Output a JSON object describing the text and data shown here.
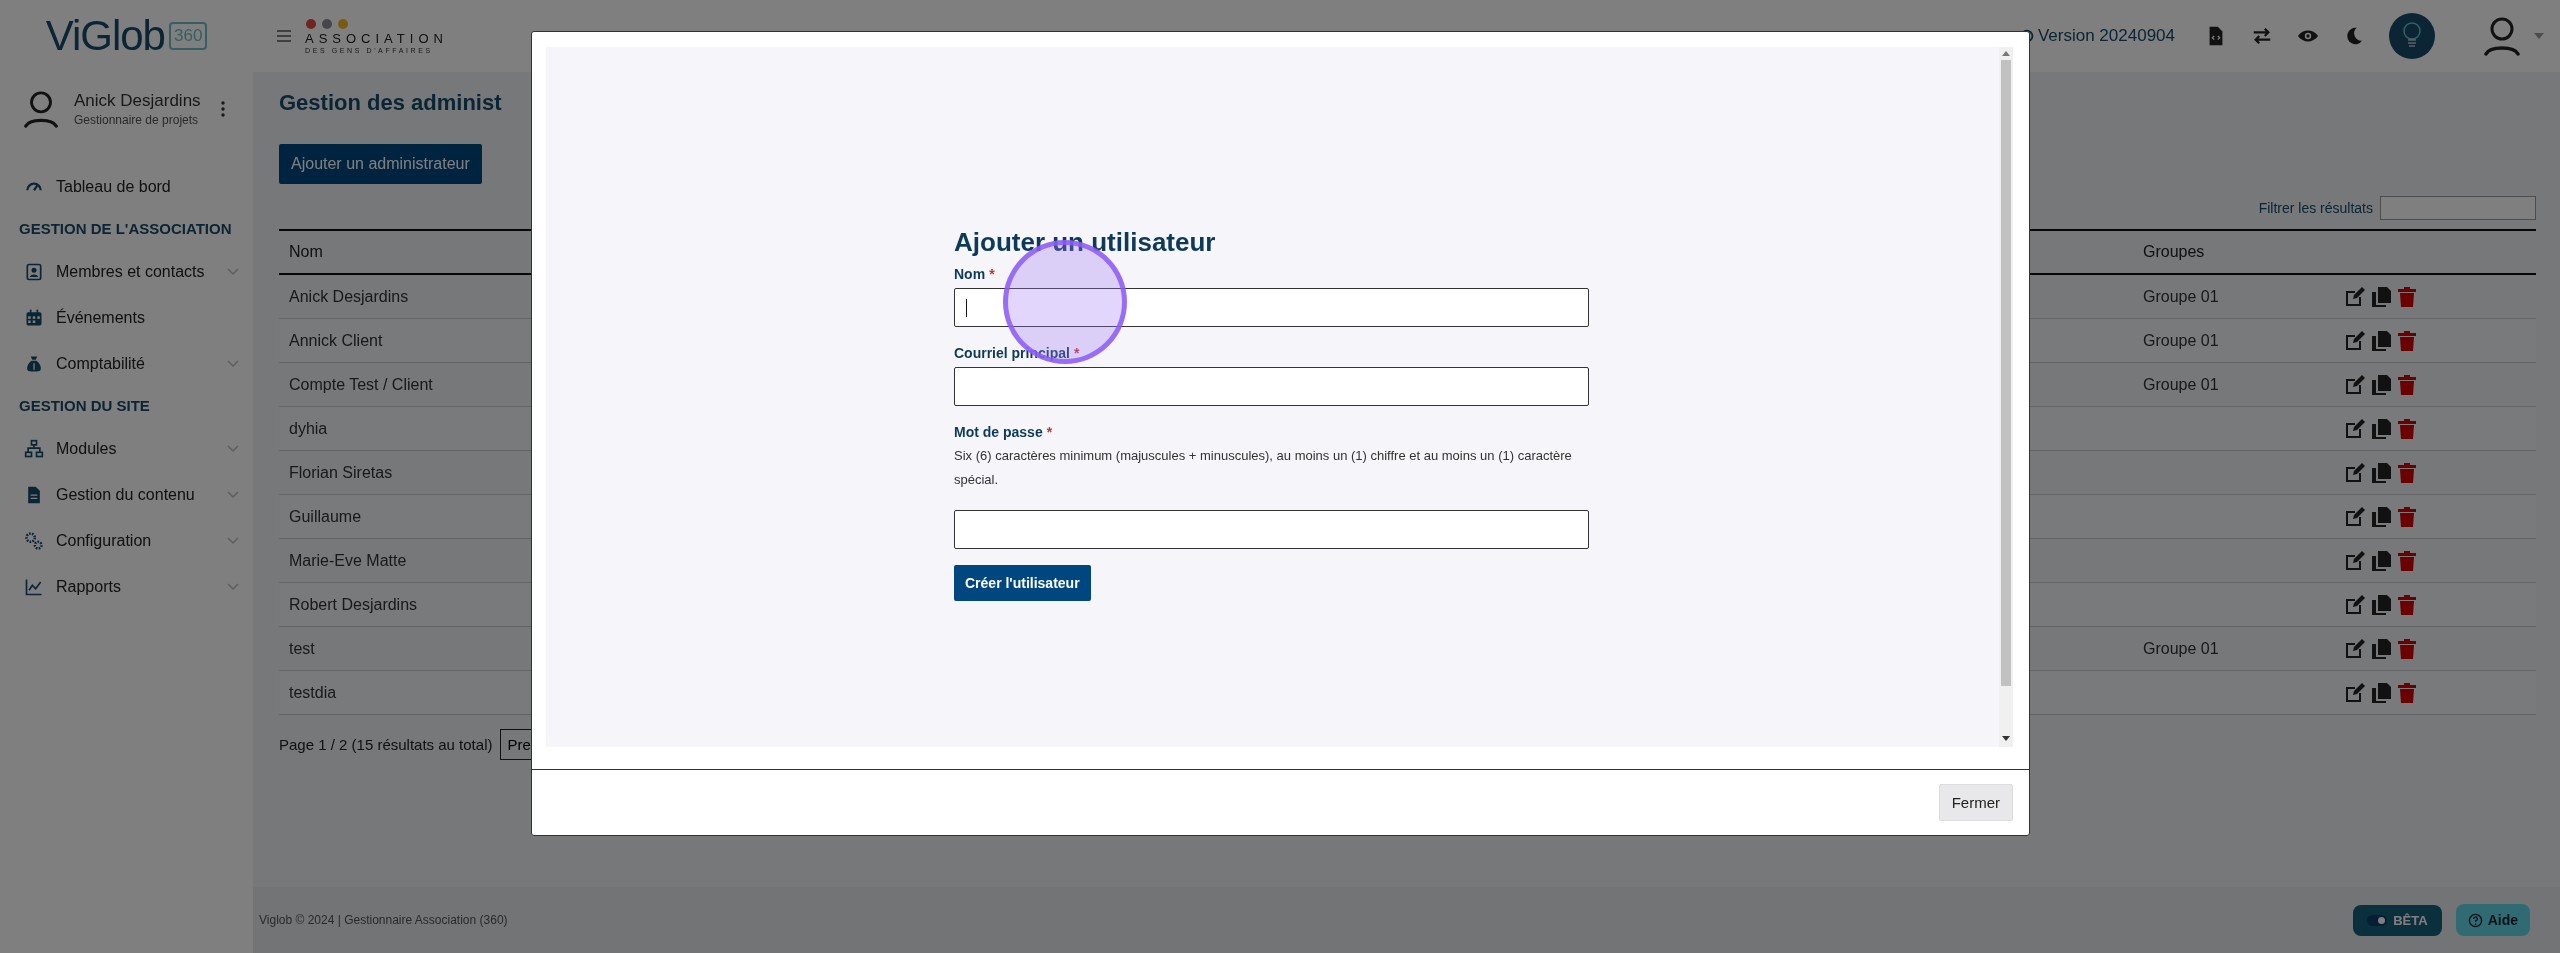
{
  "header": {
    "logo": {
      "name": "ViGlob",
      "badge": "360"
    },
    "org_logo": {
      "title": "ASSOCIATION",
      "subtitle": "DES GENS D'AFFAIRES"
    },
    "version": "Version 20240904"
  },
  "sidebar": {
    "user": {
      "name": "Anick Desjardins",
      "role": "Gestionnaire de projets"
    },
    "items": [
      {
        "kind": "link",
        "label": "Tableau de bord",
        "expandable": false
      },
      {
        "kind": "section",
        "label": "GESTION DE L'ASSOCIATION"
      },
      {
        "kind": "link",
        "label": "Membres et contacts",
        "expandable": true
      },
      {
        "kind": "link",
        "label": "Événements",
        "expandable": false
      },
      {
        "kind": "link",
        "label": "Comptabilité",
        "expandable": true
      },
      {
        "kind": "section",
        "label": "GESTION DU SITE"
      },
      {
        "kind": "link",
        "label": "Modules",
        "expandable": true
      },
      {
        "kind": "link",
        "label": "Gestion du contenu",
        "expandable": true
      },
      {
        "kind": "link",
        "label": "Configuration",
        "expandable": true
      },
      {
        "kind": "link",
        "label": "Rapports",
        "expandable": true
      }
    ]
  },
  "page": {
    "title": "Gestion des administ",
    "add_button": "Ajouter un administrateur",
    "filter_label": "Filtrer les résultats",
    "table": {
      "columns": [
        "Nom",
        "Groupes"
      ],
      "rows": [
        {
          "name": "Anick Desjardins",
          "group": "Groupe 01"
        },
        {
          "name": "Annick Client",
          "group": "Groupe 01"
        },
        {
          "name": "Compte Test / Client",
          "group": "Groupe 01"
        },
        {
          "name": "dyhia"
        },
        {
          "name": "Florian Siretas"
        },
        {
          "name": "Guillaume"
        },
        {
          "name": "Marie-Eve Matte"
        },
        {
          "name": "Robert Desjardins"
        },
        {
          "name": "test",
          "group": "Groupe 01"
        },
        {
          "name": "testdia"
        }
      ]
    },
    "pagination": {
      "summary": "Page 1 / 2 (15 résultats au total)",
      "previous": "Pre"
    }
  },
  "modal": {
    "title": "Ajouter un utilisateur",
    "required_mark": "*",
    "fields": [
      {
        "label": "Nom",
        "required": true,
        "focused": true
      },
      {
        "label": "Courriel principal",
        "required": true,
        "focused": false
      },
      {
        "label": "Mot de passe",
        "required": true,
        "focused": false,
        "help": "Six (6) caractères minimum (majuscules + minuscules), au moins un (1) chiffre et au moins un (1) caractère spécial."
      }
    ],
    "submit": "Créer l'utilisateur",
    "close": "Fermer"
  },
  "footer": {
    "copyright": "Viglob © 2024 | Gestionnaire Association (360)",
    "beta": {
      "label": "BÊTA",
      "on": true
    },
    "help": "Aide"
  }
}
